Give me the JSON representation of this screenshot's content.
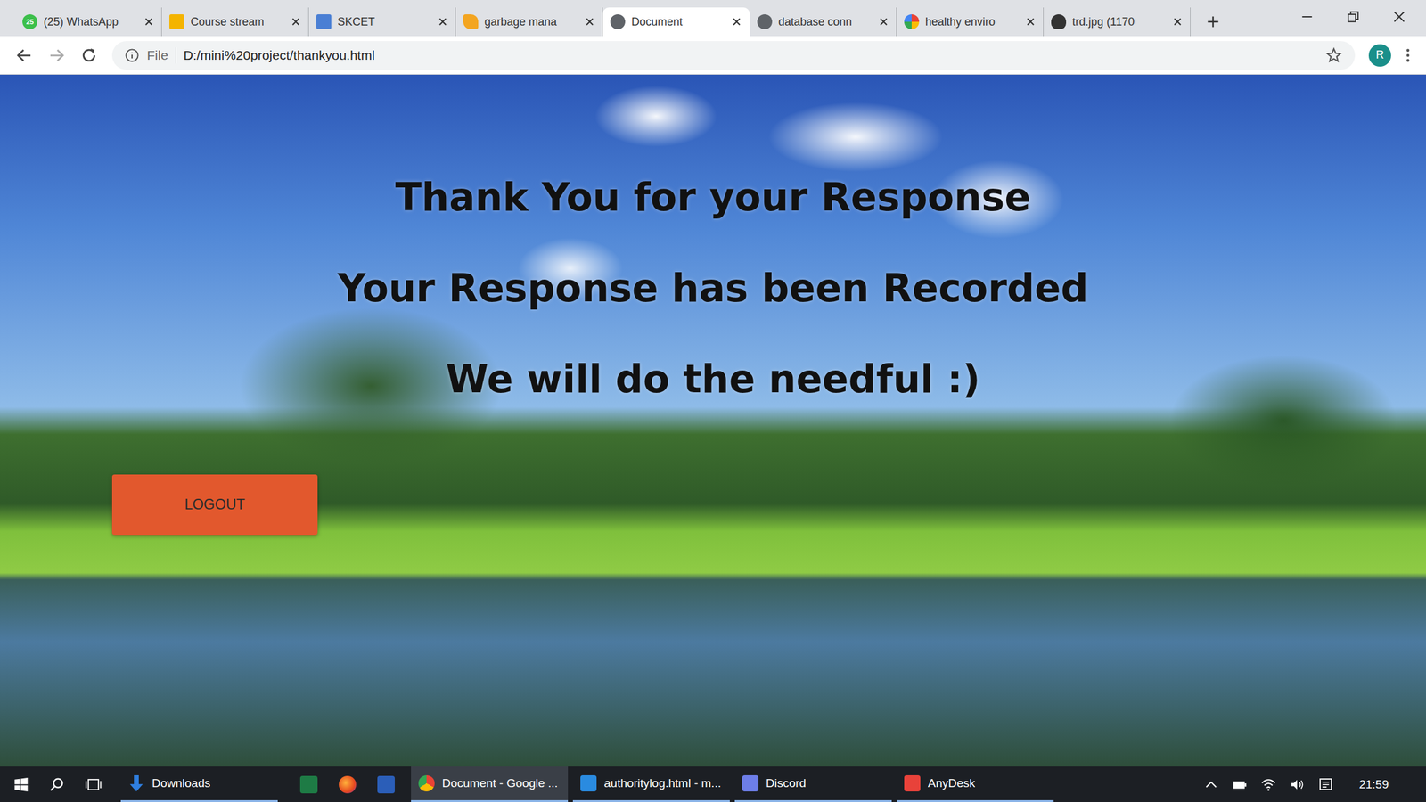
{
  "browser": {
    "tabs": [
      {
        "label": "(25) WhatsApp",
        "badge": "25",
        "selected": false
      },
      {
        "label": "Course stream",
        "selected": false
      },
      {
        "label": "SKCET",
        "selected": false
      },
      {
        "label": "garbage mana",
        "selected": false
      },
      {
        "label": "Document",
        "selected": true
      },
      {
        "label": "database conn",
        "selected": false
      },
      {
        "label": "healthy enviro",
        "selected": false
      },
      {
        "label": "trd.jpg (1170",
        "selected": false
      }
    ],
    "address_bar": {
      "scheme": "File",
      "url": "D:/mini%20project/thankyou.html"
    },
    "profile": {
      "initial": "R"
    }
  },
  "page": {
    "lines": [
      "Thank You for your Response",
      "Your Response has been Recorded",
      "We will do the needful :)"
    ],
    "logout_button": "LOGOUT"
  },
  "taskbar": {
    "items": [
      {
        "label": "Downloads",
        "selected": false
      },
      {
        "label": "Document - Google ...",
        "selected": true
      },
      {
        "label": "authoritylog.html - m...",
        "selected": false
      },
      {
        "label": "Discord",
        "selected": false
      },
      {
        "label": "AnyDesk",
        "selected": false
      }
    ],
    "time": "21:59"
  }
}
